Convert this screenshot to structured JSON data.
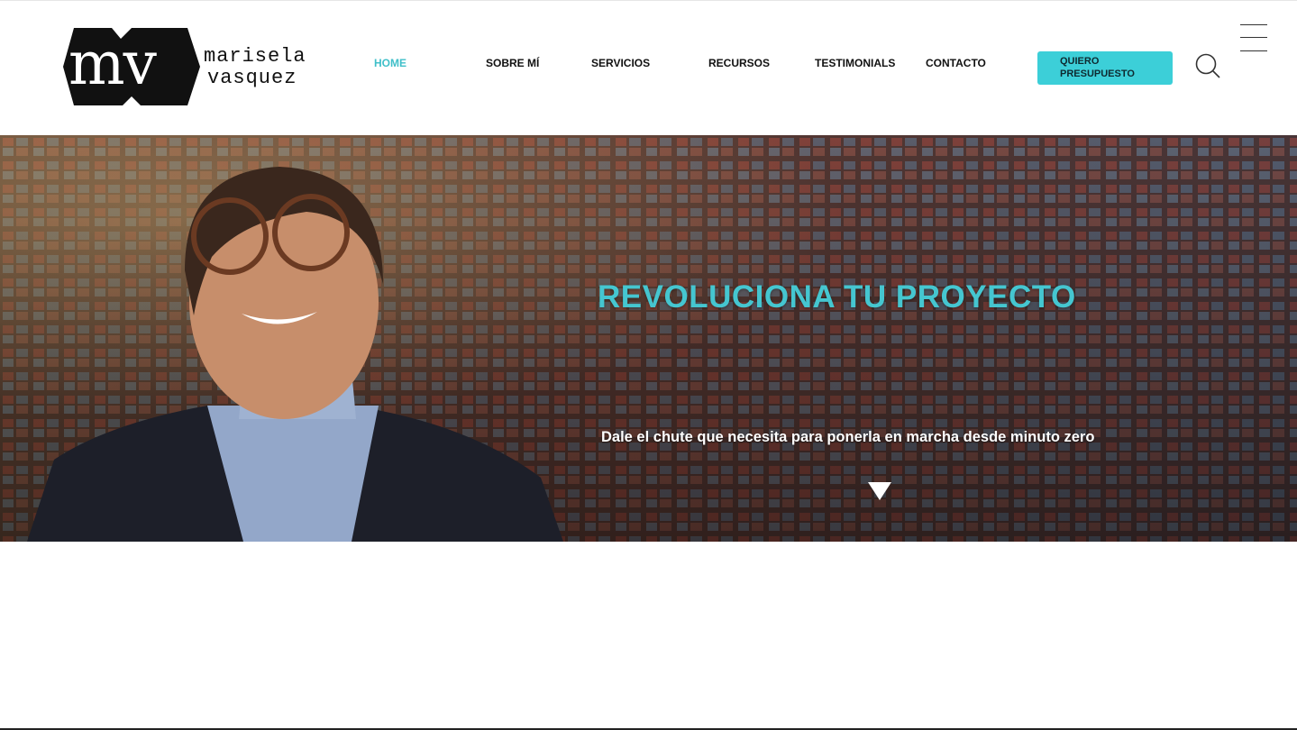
{
  "header": {
    "logo": {
      "monogram": "mv",
      "name_line1": "marisela",
      "name_line2": "vasquez"
    },
    "nav": [
      {
        "label": "HOME",
        "active": true
      },
      {
        "label": "SOBRE MÍ",
        "active": false
      },
      {
        "label": "SERVICIOS",
        "active": false
      },
      {
        "label": "RECURSOS",
        "active": false
      },
      {
        "label": "TESTIMONIALS",
        "active": false
      },
      {
        "label": "CONTACTO",
        "active": false
      }
    ],
    "cta": {
      "line1": "QUIERO",
      "line2": "PRESUPUESTO"
    },
    "icons": {
      "search": "search-icon",
      "menu": "hamburger-menu-icon"
    }
  },
  "hero": {
    "title": "REVOLUCIONA TU PROYECTO",
    "subtitle": "Dale el chute que necesita para ponerla en marcha desde minuto zero",
    "scroll_icon": "triangle-down-icon"
  },
  "colors": {
    "accent": "#45c6d0",
    "cta_bg": "#3ccfd8",
    "text": "#111111",
    "white": "#ffffff"
  }
}
